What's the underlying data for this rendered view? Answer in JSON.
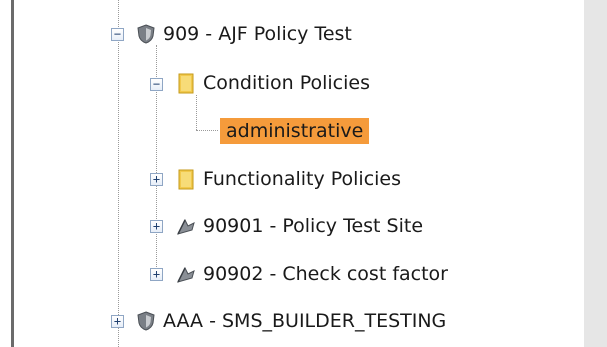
{
  "tree": {
    "nodes": [
      {
        "id": "n909",
        "label": "909 - AJF Policy Test",
        "icon": "shield-icon",
        "expander": "−"
      },
      {
        "id": "ncond",
        "label": "Condition Policies",
        "icon": "folder-icon",
        "expander": "−"
      },
      {
        "id": "nadmin",
        "label": "administrative",
        "icon": "",
        "expander": "",
        "selected": true
      },
      {
        "id": "nfunc",
        "label": "Functionality Policies",
        "icon": "folder-icon",
        "expander": "+"
      },
      {
        "id": "n90901",
        "label": "90901 - Policy Test Site",
        "icon": "flag-icon",
        "expander": "+"
      },
      {
        "id": "n90902",
        "label": "90902 - Check cost factor",
        "icon": "flag-icon",
        "expander": "+"
      },
      {
        "id": "naaa",
        "label": "AAA - SMS_BUILDER_TESTING",
        "icon": "shield-icon",
        "expander": "+"
      }
    ]
  },
  "colors": {
    "selection": "#f59b3b",
    "folder": "#f2c94c",
    "shield": "#7a7f86"
  }
}
